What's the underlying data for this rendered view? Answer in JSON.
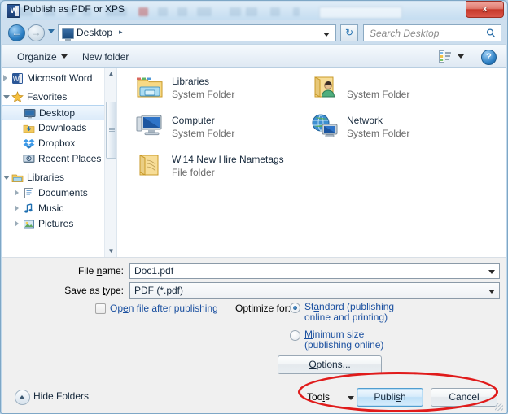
{
  "window": {
    "title": "Publish as PDF or XPS",
    "app_icon": "word-icon",
    "close_label": "x"
  },
  "nav": {
    "back_icon": "back-arrow-icon",
    "back_glyph": "←",
    "forward_icon": "forward-arrow-icon",
    "forward_glyph": "→",
    "history_icon": "history-dropdown-icon",
    "address_icon": "desktop-monitor-icon",
    "breadcrumb": "Desktop",
    "breadcrumb_separator": "▸",
    "address_dropdown_icon": "chevron-down-icon",
    "refresh_icon": "refresh-icon",
    "refresh_glyph": "↻",
    "search_placeholder": "Search Desktop",
    "search_value": "",
    "search_icon": "search-magnifier-icon"
  },
  "toolbar": {
    "organize_label": "Organize",
    "organize_caret_icon": "chevron-down-icon",
    "new_folder_label": "New folder",
    "view_icon": "view-options-icon",
    "view_caret_icon": "chevron-down-icon",
    "help_icon": "help-question-icon",
    "help_glyph": "?"
  },
  "sidebar": {
    "scroll_up_glyph": "▲",
    "scroll_down_glyph": "▼",
    "items": [
      {
        "label": "Microsoft Word",
        "icon": "word-icon",
        "indent": 0,
        "expander": "collapsed",
        "selected": false
      },
      {
        "label": "Favorites",
        "icon": "favorites-star-icon",
        "indent": 0,
        "expander": "expanded",
        "selected": false
      },
      {
        "label": "Desktop",
        "icon": "desktop-monitor-icon",
        "indent": 1,
        "expander": "none",
        "selected": true
      },
      {
        "label": "Downloads",
        "icon": "downloads-folder-icon",
        "indent": 1,
        "expander": "none",
        "selected": false
      },
      {
        "label": "Dropbox",
        "icon": "dropbox-icon",
        "indent": 1,
        "expander": "none",
        "selected": false
      },
      {
        "label": "Recent Places",
        "icon": "recent-places-icon",
        "indent": 1,
        "expander": "none",
        "selected": false
      },
      {
        "label": "Libraries",
        "icon": "libraries-icon",
        "indent": 0,
        "expander": "expanded",
        "selected": false
      },
      {
        "label": "Documents",
        "icon": "documents-library-icon",
        "indent": 1,
        "expander": "collapsed",
        "selected": false
      },
      {
        "label": "Music",
        "icon": "music-library-icon",
        "indent": 1,
        "expander": "collapsed",
        "selected": false
      },
      {
        "label": "Pictures",
        "icon": "pictures-library-icon",
        "indent": 1,
        "expander": "collapsed",
        "selected": false
      }
    ]
  },
  "file_list": {
    "items": [
      {
        "name": "Libraries",
        "type": "System Folder",
        "icon": "libraries-folder-icon",
        "name_redacted": false
      },
      {
        "name": "",
        "type": "System Folder",
        "icon": "user-folder-icon",
        "name_redacted": true
      },
      {
        "name": "Computer",
        "type": "System Folder",
        "icon": "computer-icon",
        "name_redacted": false
      },
      {
        "name": "Network",
        "type": "System Folder",
        "icon": "network-globe-icon",
        "name_redacted": false
      },
      {
        "name": "W'14 New Hire Nametags",
        "type": "File folder",
        "icon": "folder-icon",
        "name_redacted": false
      }
    ]
  },
  "form": {
    "file_name_label": "File name:",
    "file_name_accel": "n",
    "file_name_value": "Doc1.pdf",
    "save_as_type_label": "Save as type:",
    "save_as_type_accel": "t",
    "save_as_type_value": "PDF (*.pdf)",
    "open_file_label": "Open file after publishing",
    "open_file_accel": "e",
    "open_file_checked": false,
    "optimize_label": "Optimize for:",
    "options": [
      {
        "label_line1": "Standard (publishing",
        "label_line2": "online and printing)",
        "accel": "a",
        "selected": true
      },
      {
        "label_line1": "Minimum size",
        "label_line2": "(publishing online)",
        "accel": "M",
        "selected": false
      }
    ],
    "options_button_label": "Options...",
    "options_button_accel": "O"
  },
  "statusbar": {
    "hide_folders_label": "Hide Folders",
    "hide_folders_icon": "chevron-up-circle-icon",
    "tools_label": "Tools",
    "tools_caret_icon": "chevron-down-icon",
    "publish_label": "Publish",
    "cancel_label": "Cancel"
  },
  "annotations": {
    "highlight_color": "#e01b1b",
    "ellipse_target": "tools-publish-cancel-buttons"
  }
}
